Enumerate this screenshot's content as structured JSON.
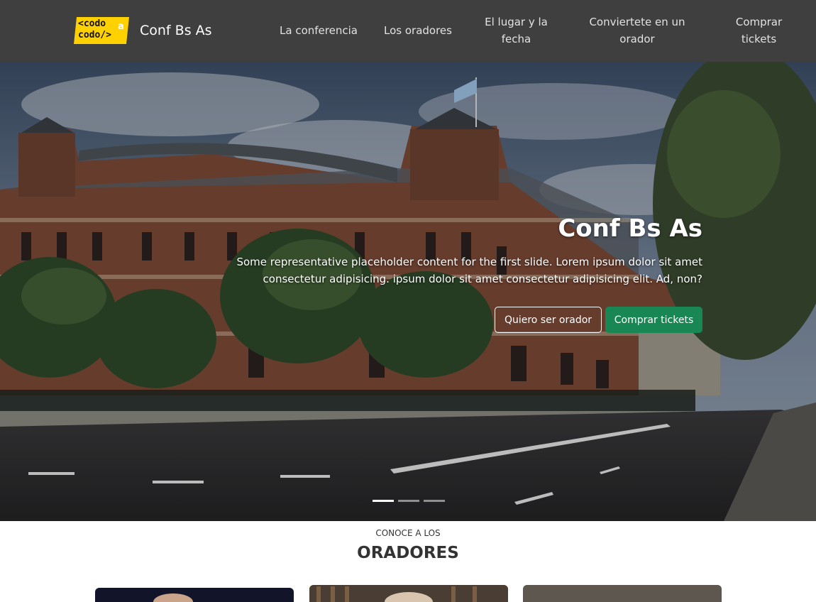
{
  "navbar": {
    "logo": {
      "line1": "<codo",
      "line2": "codo/>",
      "mark": "a",
      "icon": "codo-a-codo-logo",
      "color": "#ffd100"
    },
    "brand_name": "Conf Bs As",
    "items": [
      {
        "label": "La conferencia"
      },
      {
        "label": "Los oradores"
      },
      {
        "label": "El lugar y la fecha"
      },
      {
        "label": "Conviertete en un orador"
      },
      {
        "label": "Comprar tickets"
      }
    ],
    "background": "#3f3f3f"
  },
  "hero": {
    "title": "Conf Bs As",
    "text": "Some representative placeholder content for the first slide. Lorem ipsum dolor sit amet consectetur adipisicing. ipsum dolor sit amet consectetur adipisicing elit. Ad, non?",
    "buttons": {
      "speaker": "Quiero ser orador",
      "tickets": "Comprar tickets"
    },
    "tickets_color": "#198754",
    "active_slide": 1,
    "slide_count": 3
  },
  "speakers": {
    "subtitle": "CONOCE A LOS",
    "title": "ORADORES"
  }
}
